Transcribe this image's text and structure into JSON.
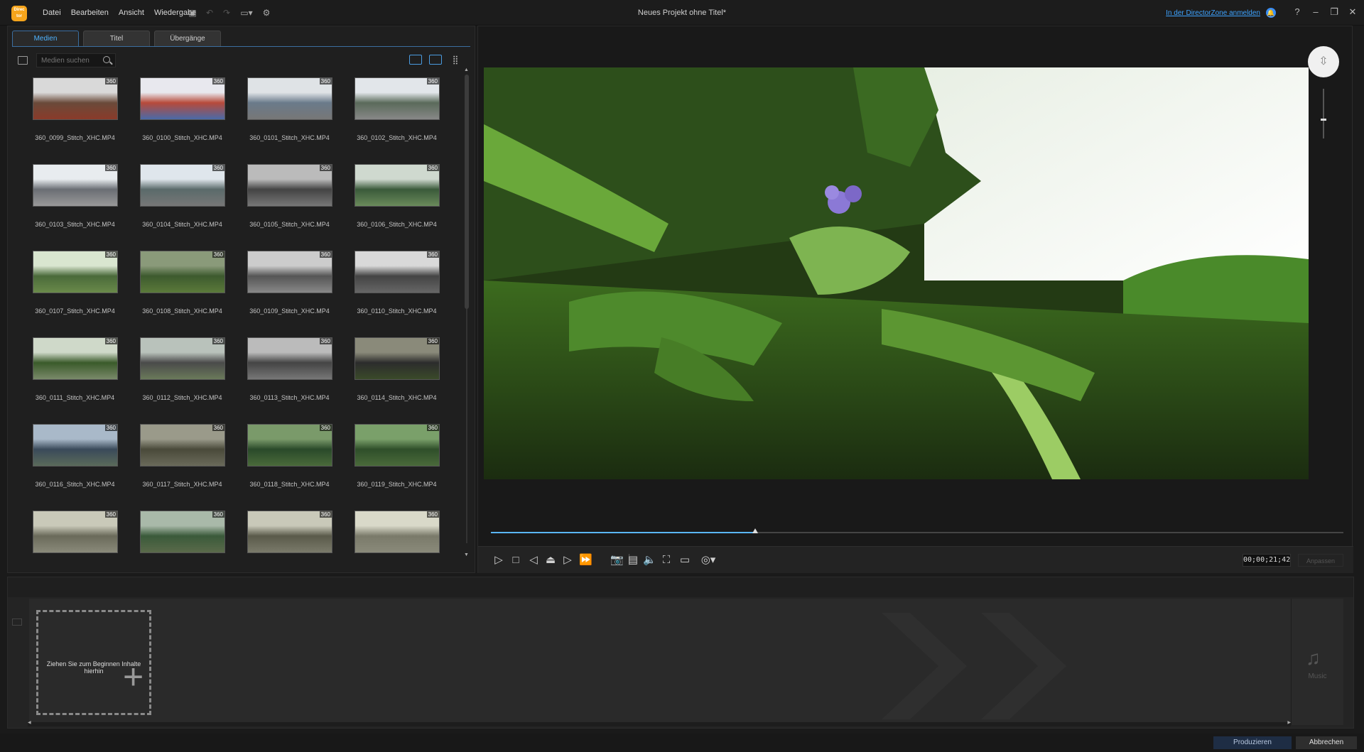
{
  "app": {
    "logo_text": "Direc tor",
    "window_title": "Neues Projekt ohne Titel*",
    "signin_link": "In der DirectorZone anmelden"
  },
  "menu": [
    "Datei",
    "Bearbeiten",
    "Ansicht",
    "Wiedergabe"
  ],
  "library": {
    "tabs": [
      {
        "label": "Medien",
        "active": true
      },
      {
        "label": "Titel",
        "active": false
      },
      {
        "label": "Übergänge",
        "active": false
      }
    ],
    "search_placeholder": "Medien suchen",
    "badge": "360",
    "thumbnails": [
      "360_0099_Stitch_XHC.MP4",
      "360_0100_Stitch_XHC.MP4",
      "360_0101_Stitch_XHC.MP4",
      "360_0102_Stitch_XHC.MP4",
      "360_0103_Stitch_XHC.MP4",
      "360_0104_Stitch_XHC.MP4",
      "360_0105_Stitch_XHC.MP4",
      "360_0106_Stitch_XHC.MP4",
      "360_0107_Stitch_XHC.MP4",
      "360_0108_Stitch_XHC.MP4",
      "360_0109_Stitch_XHC.MP4",
      "360_0110_Stitch_XHC.MP4",
      "360_0111_Stitch_XHC.MP4",
      "360_0112_Stitch_XHC.MP4",
      "360_0113_Stitch_XHC.MP4",
      "360_0114_Stitch_XHC.MP4",
      "360_0116_Stitch_XHC.MP4",
      "360_0117_Stitch_XHC.MP4",
      "360_0118_Stitch_XHC.MP4",
      "360_0119_Stitch_XHC.MP4",
      "",
      "",
      "",
      ""
    ]
  },
  "preview": {
    "timecode": "00;00;21;42",
    "quality_label": "Anpassen",
    "progress": 0.31
  },
  "timeline": {
    "drop_hint": "Ziehen Sie zum Beginnen Inhalte hierhin",
    "music_label": "Music"
  },
  "footer": {
    "produce_label": "Produzieren",
    "cancel_label": "Abbrechen"
  },
  "colors": {
    "accent": "#4fb3ff",
    "logo": "#f7a51c",
    "background": "#1a1a1a"
  }
}
